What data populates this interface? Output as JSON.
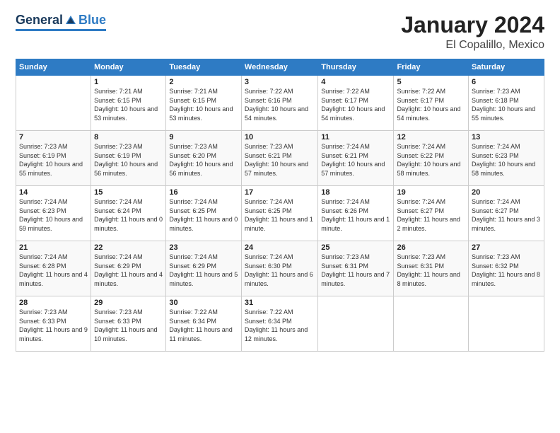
{
  "header": {
    "logo": {
      "general": "General",
      "blue": "Blue"
    },
    "month": "January 2024",
    "location": "El Copalillo, Mexico"
  },
  "weekdays": [
    "Sunday",
    "Monday",
    "Tuesday",
    "Wednesday",
    "Thursday",
    "Friday",
    "Saturday"
  ],
  "weeks": [
    [
      {
        "day": null
      },
      {
        "day": 1,
        "sunrise": "7:21 AM",
        "sunset": "6:15 PM",
        "daylight": "10 hours and 53 minutes."
      },
      {
        "day": 2,
        "sunrise": "7:21 AM",
        "sunset": "6:15 PM",
        "daylight": "10 hours and 53 minutes."
      },
      {
        "day": 3,
        "sunrise": "7:22 AM",
        "sunset": "6:16 PM",
        "daylight": "10 hours and 54 minutes."
      },
      {
        "day": 4,
        "sunrise": "7:22 AM",
        "sunset": "6:17 PM",
        "daylight": "10 hours and 54 minutes."
      },
      {
        "day": 5,
        "sunrise": "7:22 AM",
        "sunset": "6:17 PM",
        "daylight": "10 hours and 54 minutes."
      },
      {
        "day": 6,
        "sunrise": "7:23 AM",
        "sunset": "6:18 PM",
        "daylight": "10 hours and 55 minutes."
      }
    ],
    [
      {
        "day": 7,
        "sunrise": "7:23 AM",
        "sunset": "6:19 PM",
        "daylight": "10 hours and 55 minutes."
      },
      {
        "day": 8,
        "sunrise": "7:23 AM",
        "sunset": "6:19 PM",
        "daylight": "10 hours and 56 minutes."
      },
      {
        "day": 9,
        "sunrise": "7:23 AM",
        "sunset": "6:20 PM",
        "daylight": "10 hours and 56 minutes."
      },
      {
        "day": 10,
        "sunrise": "7:23 AM",
        "sunset": "6:21 PM",
        "daylight": "10 hours and 57 minutes."
      },
      {
        "day": 11,
        "sunrise": "7:24 AM",
        "sunset": "6:21 PM",
        "daylight": "10 hours and 57 minutes."
      },
      {
        "day": 12,
        "sunrise": "7:24 AM",
        "sunset": "6:22 PM",
        "daylight": "10 hours and 58 minutes."
      },
      {
        "day": 13,
        "sunrise": "7:24 AM",
        "sunset": "6:23 PM",
        "daylight": "10 hours and 58 minutes."
      }
    ],
    [
      {
        "day": 14,
        "sunrise": "7:24 AM",
        "sunset": "6:23 PM",
        "daylight": "10 hours and 59 minutes."
      },
      {
        "day": 15,
        "sunrise": "7:24 AM",
        "sunset": "6:24 PM",
        "daylight": "11 hours and 0 minutes."
      },
      {
        "day": 16,
        "sunrise": "7:24 AM",
        "sunset": "6:25 PM",
        "daylight": "11 hours and 0 minutes."
      },
      {
        "day": 17,
        "sunrise": "7:24 AM",
        "sunset": "6:25 PM",
        "daylight": "11 hours and 1 minute."
      },
      {
        "day": 18,
        "sunrise": "7:24 AM",
        "sunset": "6:26 PM",
        "daylight": "11 hours and 1 minute."
      },
      {
        "day": 19,
        "sunrise": "7:24 AM",
        "sunset": "6:27 PM",
        "daylight": "11 hours and 2 minutes."
      },
      {
        "day": 20,
        "sunrise": "7:24 AM",
        "sunset": "6:27 PM",
        "daylight": "11 hours and 3 minutes."
      }
    ],
    [
      {
        "day": 21,
        "sunrise": "7:24 AM",
        "sunset": "6:28 PM",
        "daylight": "11 hours and 4 minutes."
      },
      {
        "day": 22,
        "sunrise": "7:24 AM",
        "sunset": "6:29 PM",
        "daylight": "11 hours and 4 minutes."
      },
      {
        "day": 23,
        "sunrise": "7:24 AM",
        "sunset": "6:29 PM",
        "daylight": "11 hours and 5 minutes."
      },
      {
        "day": 24,
        "sunrise": "7:24 AM",
        "sunset": "6:30 PM",
        "daylight": "11 hours and 6 minutes."
      },
      {
        "day": 25,
        "sunrise": "7:23 AM",
        "sunset": "6:31 PM",
        "daylight": "11 hours and 7 minutes."
      },
      {
        "day": 26,
        "sunrise": "7:23 AM",
        "sunset": "6:31 PM",
        "daylight": "11 hours and 8 minutes."
      },
      {
        "day": 27,
        "sunrise": "7:23 AM",
        "sunset": "6:32 PM",
        "daylight": "11 hours and 8 minutes."
      }
    ],
    [
      {
        "day": 28,
        "sunrise": "7:23 AM",
        "sunset": "6:33 PM",
        "daylight": "11 hours and 9 minutes."
      },
      {
        "day": 29,
        "sunrise": "7:23 AM",
        "sunset": "6:33 PM",
        "daylight": "11 hours and 10 minutes."
      },
      {
        "day": 30,
        "sunrise": "7:22 AM",
        "sunset": "6:34 PM",
        "daylight": "11 hours and 11 minutes."
      },
      {
        "day": 31,
        "sunrise": "7:22 AM",
        "sunset": "6:34 PM",
        "daylight": "11 hours and 12 minutes."
      },
      {
        "day": null
      },
      {
        "day": null
      },
      {
        "day": null
      }
    ]
  ]
}
